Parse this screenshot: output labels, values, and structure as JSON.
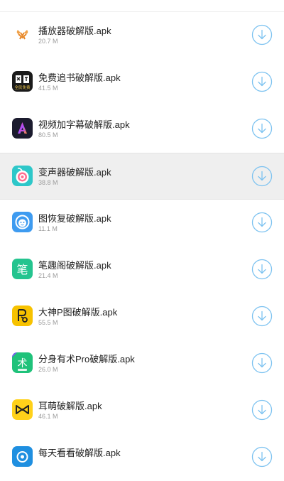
{
  "accent_color": "#7cc2f0",
  "files": [
    {
      "name": "播放器破解版.apk",
      "size": "20.7 M",
      "icon": "player-app-icon"
    },
    {
      "name": "免费追书破解版.apk",
      "size": "41.5 M",
      "icon": "free-books-app-icon",
      "icon_text": "全民免费"
    },
    {
      "name": "视频加字幕破解版.apk",
      "size": "80.5 M",
      "icon": "video-subtitle-app-icon"
    },
    {
      "name": "变声器破解版.apk",
      "size": "38.8 M",
      "icon": "voice-changer-app-icon"
    },
    {
      "name": "图恢复破解版.apk",
      "size": "11.1 M",
      "icon": "photo-recovery-app-icon"
    },
    {
      "name": "笔趣阁破解版.apk",
      "size": "21.4 M",
      "icon": "biquge-app-icon",
      "icon_text": "笔"
    },
    {
      "name": "大神P图破解版.apk",
      "size": "55.5 M",
      "icon": "p-photo-app-icon"
    },
    {
      "name": "分身有术Pro破解版.apk",
      "size": "26.0 M",
      "icon": "app-clone-app-icon",
      "icon_text": "术"
    },
    {
      "name": "耳萌破解版.apk",
      "size": "46.1 M",
      "icon": "ermeng-app-icon"
    },
    {
      "name": "每天看看破解版.apk",
      "size": "",
      "icon": "daily-look-app-icon"
    }
  ]
}
